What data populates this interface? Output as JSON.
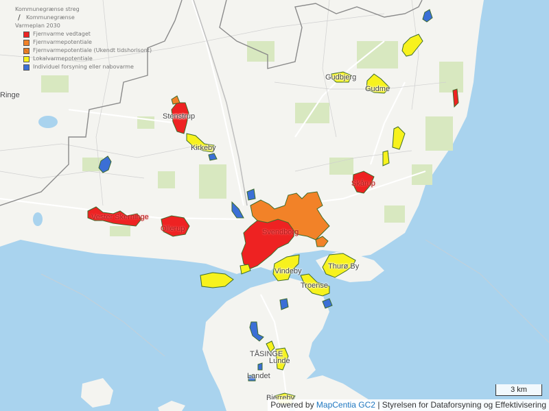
{
  "legend": {
    "layers": [
      {
        "label": "Kommunegrænse streg"
      },
      {
        "label": "Kommunegrænse",
        "icon": "line-icon"
      }
    ],
    "group_title": "Varmeplan 2030",
    "items": [
      {
        "label": "Fjernvarme vedtaget",
        "color": "#ee2222"
      },
      {
        "label": "Fjernvarmepotentiale",
        "color": "#f28228"
      },
      {
        "label": "Fjernvarmepotentiale (Ukendt tidshorisont)",
        "color": "#d9731f"
      },
      {
        "label": "Lokalvarmepotentiale",
        "color": "#f7f21d"
      },
      {
        "label": "Individuel forsyning eller nabovarme",
        "color": "#3b6fd6"
      }
    ]
  },
  "places": [
    {
      "name": "Svendborg",
      "style": "red"
    },
    {
      "name": "Stenstrup",
      "style": "red"
    },
    {
      "name": "Kirkeby",
      "style": "plain"
    },
    {
      "name": "Gudbjerg",
      "style": "plain"
    },
    {
      "name": "Gudme",
      "style": "plain"
    },
    {
      "name": "Skårup",
      "style": "red"
    },
    {
      "name": "Vester Skerninge",
      "style": "red"
    },
    {
      "name": "Ollerup",
      "style": "red"
    },
    {
      "name": "Vindeby",
      "style": "plain"
    },
    {
      "name": "Thurø By",
      "style": "plain"
    },
    {
      "name": "Troense",
      "style": "plain"
    },
    {
      "name": "TÅSINGE",
      "style": "plain"
    },
    {
      "name": "Landet",
      "style": "plain"
    },
    {
      "name": "Lunde",
      "style": "plain"
    },
    {
      "name": "Bjerreby",
      "style": "plain"
    },
    {
      "name": "Ringe",
      "style": "plain"
    }
  ],
  "scale": {
    "label": "3 km"
  },
  "attribution": {
    "prefix": "Powered by",
    "link": "MapCentia GC2",
    "suffix": "| Styrelsen for Dataforsyning og Effektivisering"
  },
  "colors": {
    "sea": "#a9d3ee",
    "land": "#f4f4f0",
    "forest": "#d8e8c0",
    "boundary": "#8a8a8a"
  }
}
